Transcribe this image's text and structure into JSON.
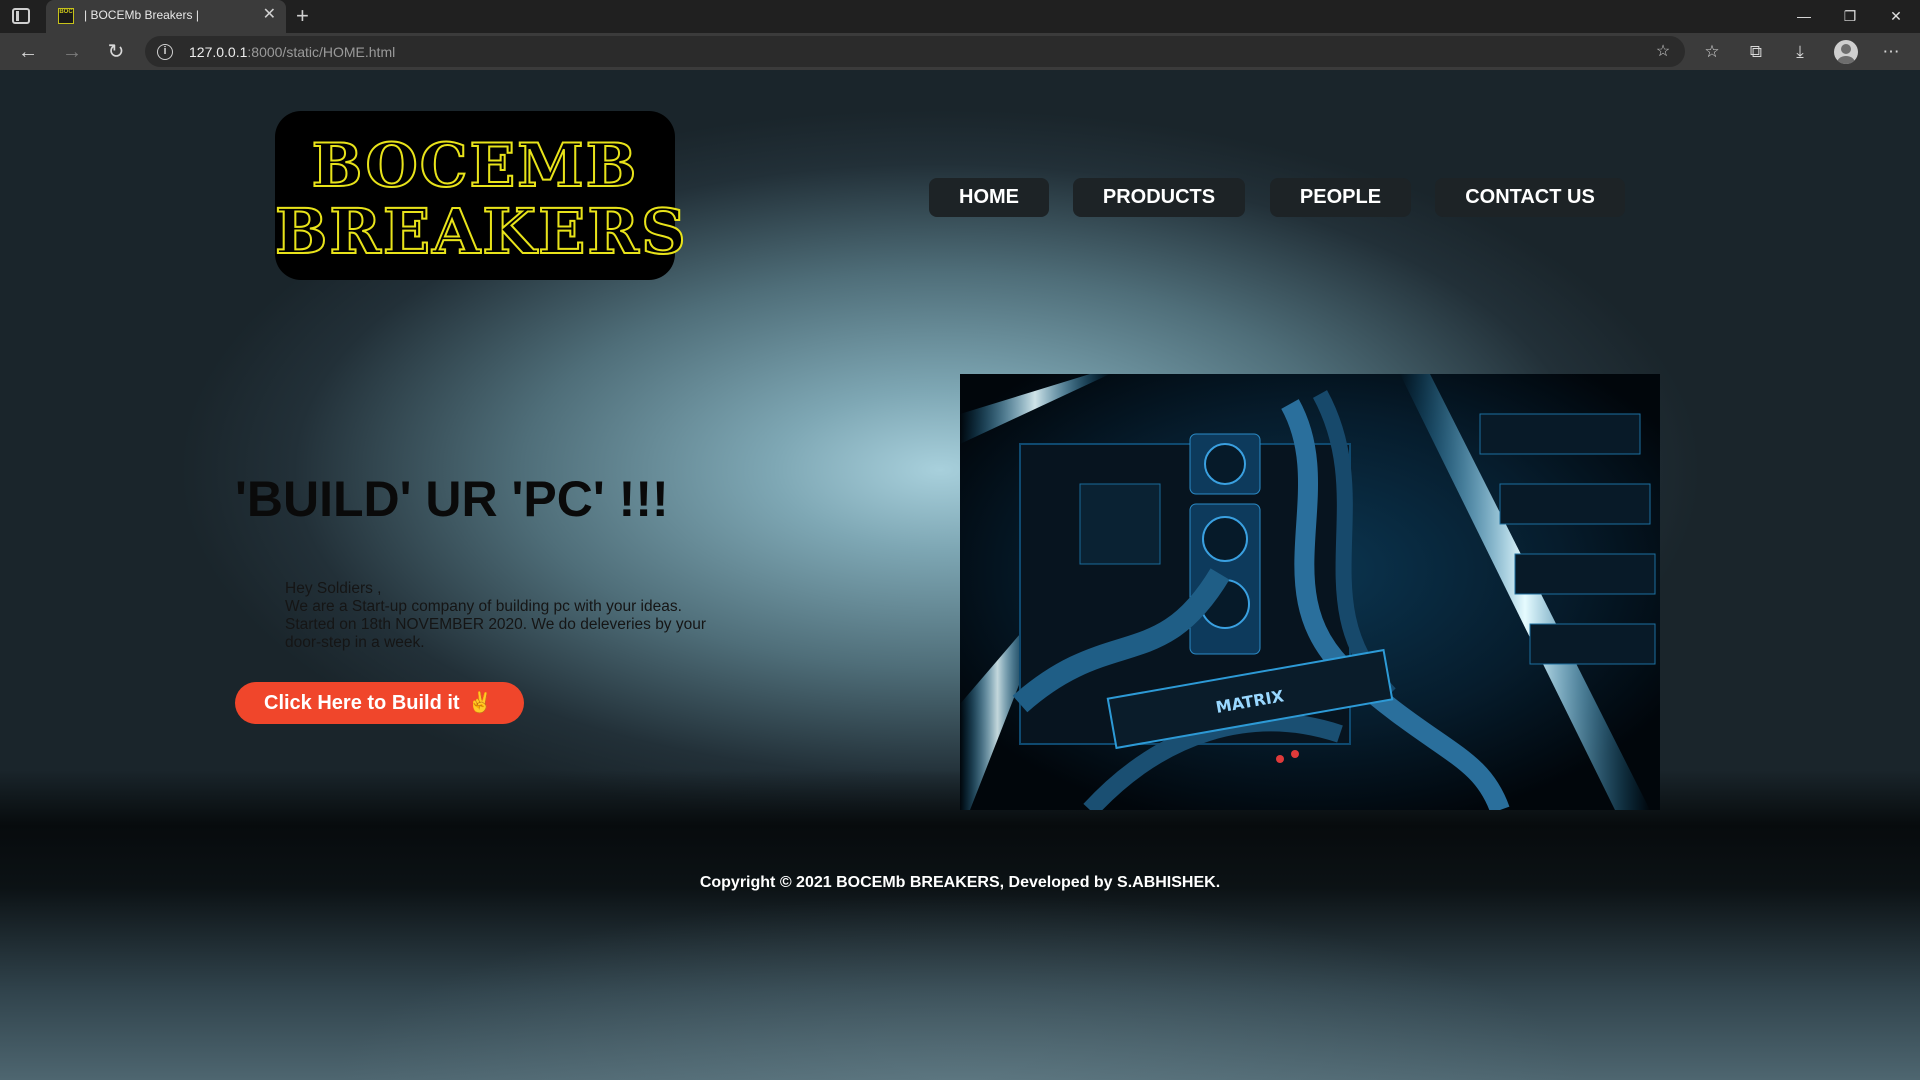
{
  "browser": {
    "tab_title": "| BOCEMb Breakers |",
    "favicon_text": "BOC",
    "tab_close": "✕",
    "new_tab": "+",
    "url_host": "127.0.0.1",
    "url_rest": ":8000/static/HOME.html",
    "info_icon": "i",
    "window_minimize": "—",
    "window_restore": "❐",
    "window_close": "✕",
    "back": "←",
    "forward": "→",
    "reload": "↻",
    "add_favorite": "☆",
    "favorites": "☆",
    "collections": "⧉",
    "downloads": "⤓",
    "menu": "⋯"
  },
  "logo": {
    "line1": "BOCEMB",
    "line2": "BREAKERS",
    "accent_color": "#e8e31a"
  },
  "nav": {
    "home": "HOME",
    "products": "PRODUCTS",
    "people": "PEOPLE",
    "contact": "CONTACT US"
  },
  "hero": {
    "title": "'BUILD' UR 'PC' !!!",
    "greeting": "Hey Soldiers ,",
    "line1": "We are a Start-up company of building pc with your ideas.",
    "line2": "Started on 18th NOVEMBER 2020. We do deleveries by your door-step in a week.",
    "cta_label": "Click Here to Build it",
    "cta_icon": "✌",
    "cta_color": "#f0462b",
    "image_label": "MATRIX"
  },
  "footer": {
    "copyright": "Copyright © 2021 BOCEMb BREAKERS, Developed by S.ABHISHEK."
  }
}
